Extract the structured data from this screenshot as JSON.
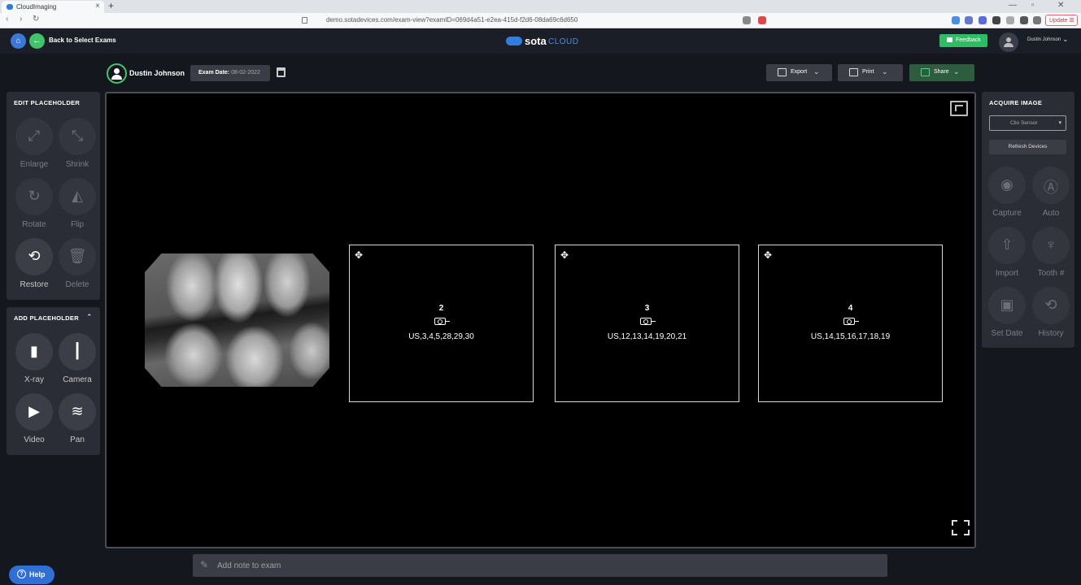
{
  "browser": {
    "tab_title": "CloudImaging",
    "url": "demo.sotadevices.com/exam-view?examID=069d4a51-e2ea-415d-f2d6-08da69c6d650",
    "update_label": "Update"
  },
  "header": {
    "back_label": "Back to Select Exams",
    "logo_sota": "sota",
    "logo_cloud": "CLOUD",
    "feedback_label": "Feedback",
    "user_name": "Dustin Johnson"
  },
  "patient": {
    "name": "Dustin Johnson",
    "exam_date_label": "Exam Date:",
    "exam_date_value": "08-02-2022"
  },
  "actions": {
    "export": "Export",
    "print": "Print",
    "share": "Share"
  },
  "edit_panel": {
    "title": "EDIT PLACEHOLDER",
    "tools": [
      "Enlarge",
      "Shrink",
      "Rotate",
      "Flip",
      "Restore",
      "Delete"
    ]
  },
  "add_panel": {
    "title": "ADD PLACEHOLDER",
    "tools": [
      "X-ray",
      "Camera",
      "Video",
      "Pan"
    ]
  },
  "placeholders": [
    {
      "number": "2",
      "teeth": "US,3,4,5,28,29,30"
    },
    {
      "number": "3",
      "teeth": "US,12,13,14,19,20,21"
    },
    {
      "number": "4",
      "teeth": "US,14,15,16,17,18,19"
    }
  ],
  "acquire_panel": {
    "title": "ACQUIRE IMAGE",
    "sensor": "Clio Sensor",
    "refresh": "Refresh Devices",
    "tools": [
      "Capture",
      "Auto",
      "Import",
      "Tooth #",
      "Set Date",
      "History"
    ]
  },
  "note": {
    "placeholder": "Add note to exam"
  },
  "help_label": "Help",
  "colors": {
    "accent_green": "#3fc46a",
    "accent_blue": "#2f6fd6",
    "background": "#15171f"
  }
}
